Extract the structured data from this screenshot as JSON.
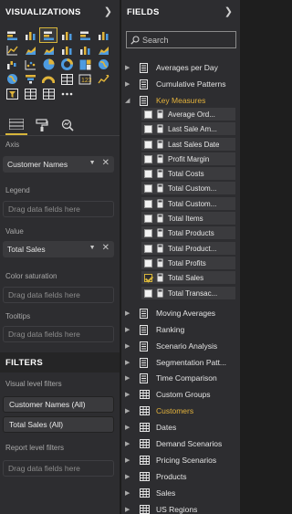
{
  "visualizations": {
    "title": "VISUALIZATIONS",
    "icon_rows": [
      [
        "stacked-bar-icon",
        "stacked-column-icon",
        "clustered-bar-icon",
        "clustered-column-icon",
        "100-bar-icon",
        "100-column-icon"
      ],
      [
        "line-icon",
        "area-icon",
        "stacked-area-icon",
        "line-column-icon",
        "line-clustered-icon",
        "ribbon-icon"
      ],
      [
        "waterfall-icon",
        "scatter-icon",
        "pie-icon",
        "donut-icon",
        "treemap-icon",
        "map-icon"
      ],
      [
        "filled-map-icon",
        "funnel-icon",
        "gauge-icon",
        "multirow-card-icon",
        "card-icon",
        "kpi-icon"
      ],
      [
        "slicer-icon",
        "table-icon",
        "matrix-icon",
        "more-icon"
      ]
    ],
    "wells": {
      "axis": {
        "label": "Axis",
        "value": "Customer Names"
      },
      "legend": {
        "label": "Legend",
        "placeholder": "Drag data fields here"
      },
      "value": {
        "label": "Value",
        "value": "Total Sales"
      },
      "color_saturation": {
        "label": "Color saturation",
        "placeholder": "Drag data fields here"
      },
      "tooltips": {
        "label": "Tooltips",
        "placeholder": "Drag data fields here"
      }
    }
  },
  "filters": {
    "title": "FILTERS",
    "visual_level_label": "Visual level filters",
    "visual_level_items": [
      "Customer Names (All)",
      "Total Sales  (All)"
    ],
    "report_level_label": "Report level filters",
    "report_level_placeholder": "Drag data fields here"
  },
  "fields": {
    "title": "FIELDS",
    "search_placeholder": "Search",
    "tables_top": [
      {
        "name": "Averages per Day",
        "type": "measure-table"
      },
      {
        "name": "Cumulative Patterns",
        "type": "measure-table"
      }
    ],
    "expanded_table": "Key Measures",
    "measures": [
      {
        "name": "Average Ord...",
        "checked": false
      },
      {
        "name": "Last Sale Am...",
        "checked": false
      },
      {
        "name": "Last Sales Date",
        "checked": false
      },
      {
        "name": "Profit Margin",
        "checked": false
      },
      {
        "name": "Total Costs",
        "checked": false
      },
      {
        "name": "Total Custom...",
        "checked": false
      },
      {
        "name": "Total Custom...",
        "checked": false
      },
      {
        "name": "Total Items",
        "checked": false
      },
      {
        "name": "Total Products",
        "checked": false
      },
      {
        "name": "Total Product...",
        "checked": false
      },
      {
        "name": "Total Profits",
        "checked": false
      },
      {
        "name": "Total Sales",
        "checked": true
      },
      {
        "name": "Total Transac...",
        "checked": false
      }
    ],
    "tables_bottom": [
      {
        "name": "Moving Averages",
        "type": "measure-table",
        "highlight": false
      },
      {
        "name": "Ranking",
        "type": "measure-table",
        "highlight": false
      },
      {
        "name": "Scenario Analysis",
        "type": "measure-table",
        "highlight": false
      },
      {
        "name": "Segmentation Patt...",
        "type": "measure-table",
        "highlight": false
      },
      {
        "name": "Time Comparison",
        "type": "measure-table",
        "highlight": false
      },
      {
        "name": "Custom Groups",
        "type": "table",
        "highlight": false
      },
      {
        "name": "Customers",
        "type": "table",
        "highlight": true
      },
      {
        "name": "Dates",
        "type": "table",
        "highlight": false
      },
      {
        "name": "Demand Scenarios",
        "type": "table",
        "highlight": false
      },
      {
        "name": "Pricing Scenarios",
        "type": "table",
        "highlight": false
      },
      {
        "name": "Products",
        "type": "table",
        "highlight": false
      },
      {
        "name": "Sales",
        "type": "table",
        "highlight": false
      },
      {
        "name": "US Regions",
        "type": "table",
        "highlight": false
      }
    ]
  },
  "colors": {
    "accent": "#d7b53b",
    "highlight_text": "#e3b23c",
    "pane_bg": "#2d2d30"
  }
}
